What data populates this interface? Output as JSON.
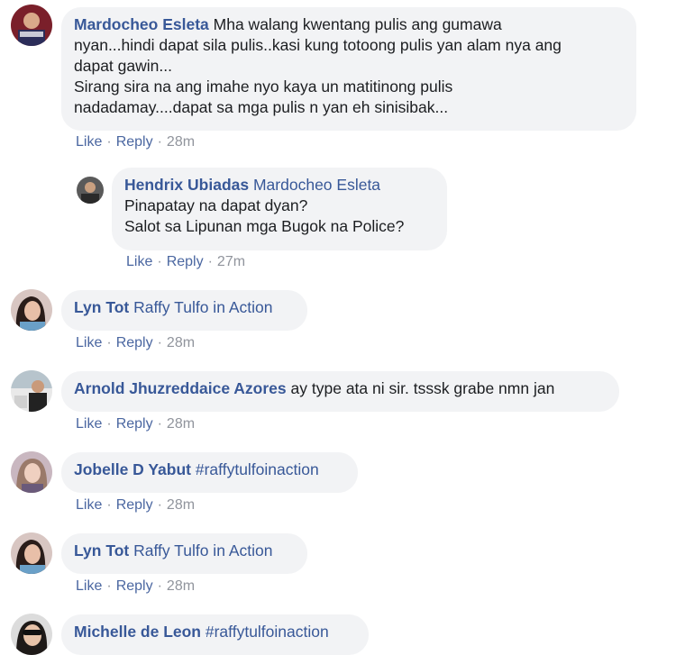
{
  "comments": [
    {
      "author": "Mardocheo Esleta",
      "lines": [
        "Mha walang kwentang pulis ang gumawa",
        "nyan...hindi dapat sila pulis..kasi kung totoong pulis yan alam nya ang",
        "dapat gawin...",
        "Sirang sira na ang imahe nyo kaya un matitinong pulis",
        "nadadamay....dapat sa mga pulis n yan eh sinisibak..."
      ],
      "like": "Like",
      "reply": "Reply",
      "time": "28m"
    },
    {
      "author": "Hendrix Ubiadas",
      "mention": "Mardocheo Esleta",
      "lines": [
        "Pinapatay na dapat dyan?",
        "Salot sa Lipunan mga Bugok na Police?"
      ],
      "like": "Like",
      "reply": "Reply",
      "time": "27m"
    },
    {
      "author": "Lyn Tot",
      "mention": "Raffy Tulfo in Action",
      "like": "Like",
      "reply": "Reply",
      "time": "28m"
    },
    {
      "author": "Arnold Jhuzreddaice Azores",
      "text": "ay type ata ni sir. tsssk grabe nmn jan",
      "like": "Like",
      "reply": "Reply",
      "time": "28m"
    },
    {
      "author": "Jobelle D Yabut",
      "mention": "#raffytulfoinaction",
      "like": "Like",
      "reply": "Reply",
      "time": "28m"
    },
    {
      "author": "Lyn Tot",
      "mention": "Raffy Tulfo in Action",
      "like": "Like",
      "reply": "Reply",
      "time": "28m"
    },
    {
      "author": "Michelle de Leon",
      "mention": "#raffytulfoinaction"
    }
  ],
  "separator": "·",
  "colors": {
    "link": "#385898",
    "bubble": "#f2f3f5",
    "meta": "#90949c"
  }
}
